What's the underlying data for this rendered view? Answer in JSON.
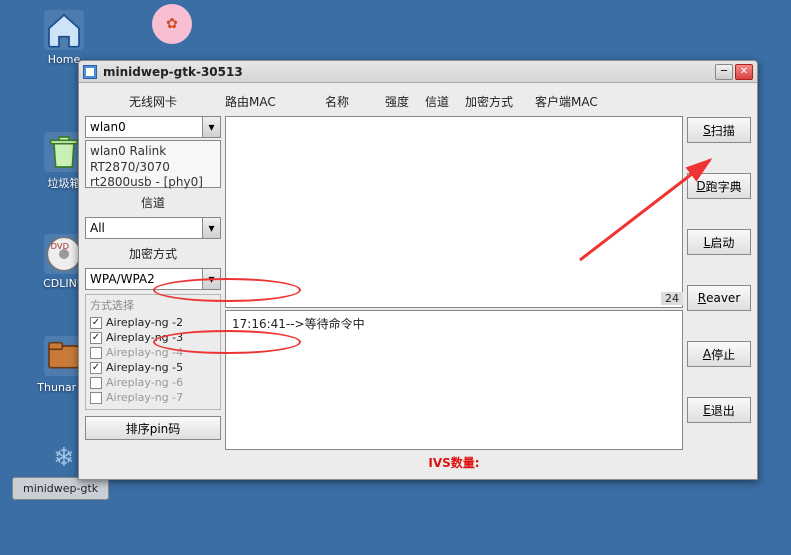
{
  "desktop": {
    "home": "Home",
    "trash": "垃圾箱",
    "cdlinux": "CDLINU",
    "thunar": "Thunar 文",
    "pink": ""
  },
  "taskbar": {
    "task1": "minidwep-gtk"
  },
  "window": {
    "title": "minidwep-gtk-30513"
  },
  "left": {
    "adapter_label": "无线网卡",
    "adapter_select": "wlan0",
    "adapter_info_l1": "wlan0 Ralink",
    "adapter_info_l2": "RT2870/3070",
    "adapter_info_l3": "rt2800usb - [phy0]",
    "channel_label": "信道",
    "channel_select": "All",
    "enc_label": "加密方式",
    "enc_select": "WPA/WPA2",
    "mode_title": "方式选择",
    "modes": [
      {
        "label": "Aireplay-ng -2",
        "checked": true
      },
      {
        "label": "Aireplay-ng -3",
        "checked": true
      },
      {
        "label": "Aireplay-ng -4",
        "checked": false
      },
      {
        "label": "Aireplay-ng -5",
        "checked": true
      },
      {
        "label": "Aireplay-ng -6",
        "checked": false
      },
      {
        "label": "Aireplay-ng -7",
        "checked": false
      }
    ],
    "sort_pin": "排序pin码"
  },
  "headers": {
    "mac": "路由MAC",
    "name": "名称",
    "strength": "强度",
    "channel": "信道",
    "enc": "加密方式",
    "client_mac": "客户端MAC"
  },
  "center": {
    "count": "24",
    "log1": "17:16:41-->等待命令中",
    "ivs": "IVS数量:"
  },
  "right": {
    "scan_u": "S",
    "scan": "扫描",
    "dict_u": "D",
    "dict": "跑字典",
    "start_u": "L",
    "start": "启动",
    "reaver_u": "R",
    "reaver": "eaver",
    "stop_u": "A",
    "stop": "停止",
    "exit_u": "E",
    "exit": "退出"
  }
}
